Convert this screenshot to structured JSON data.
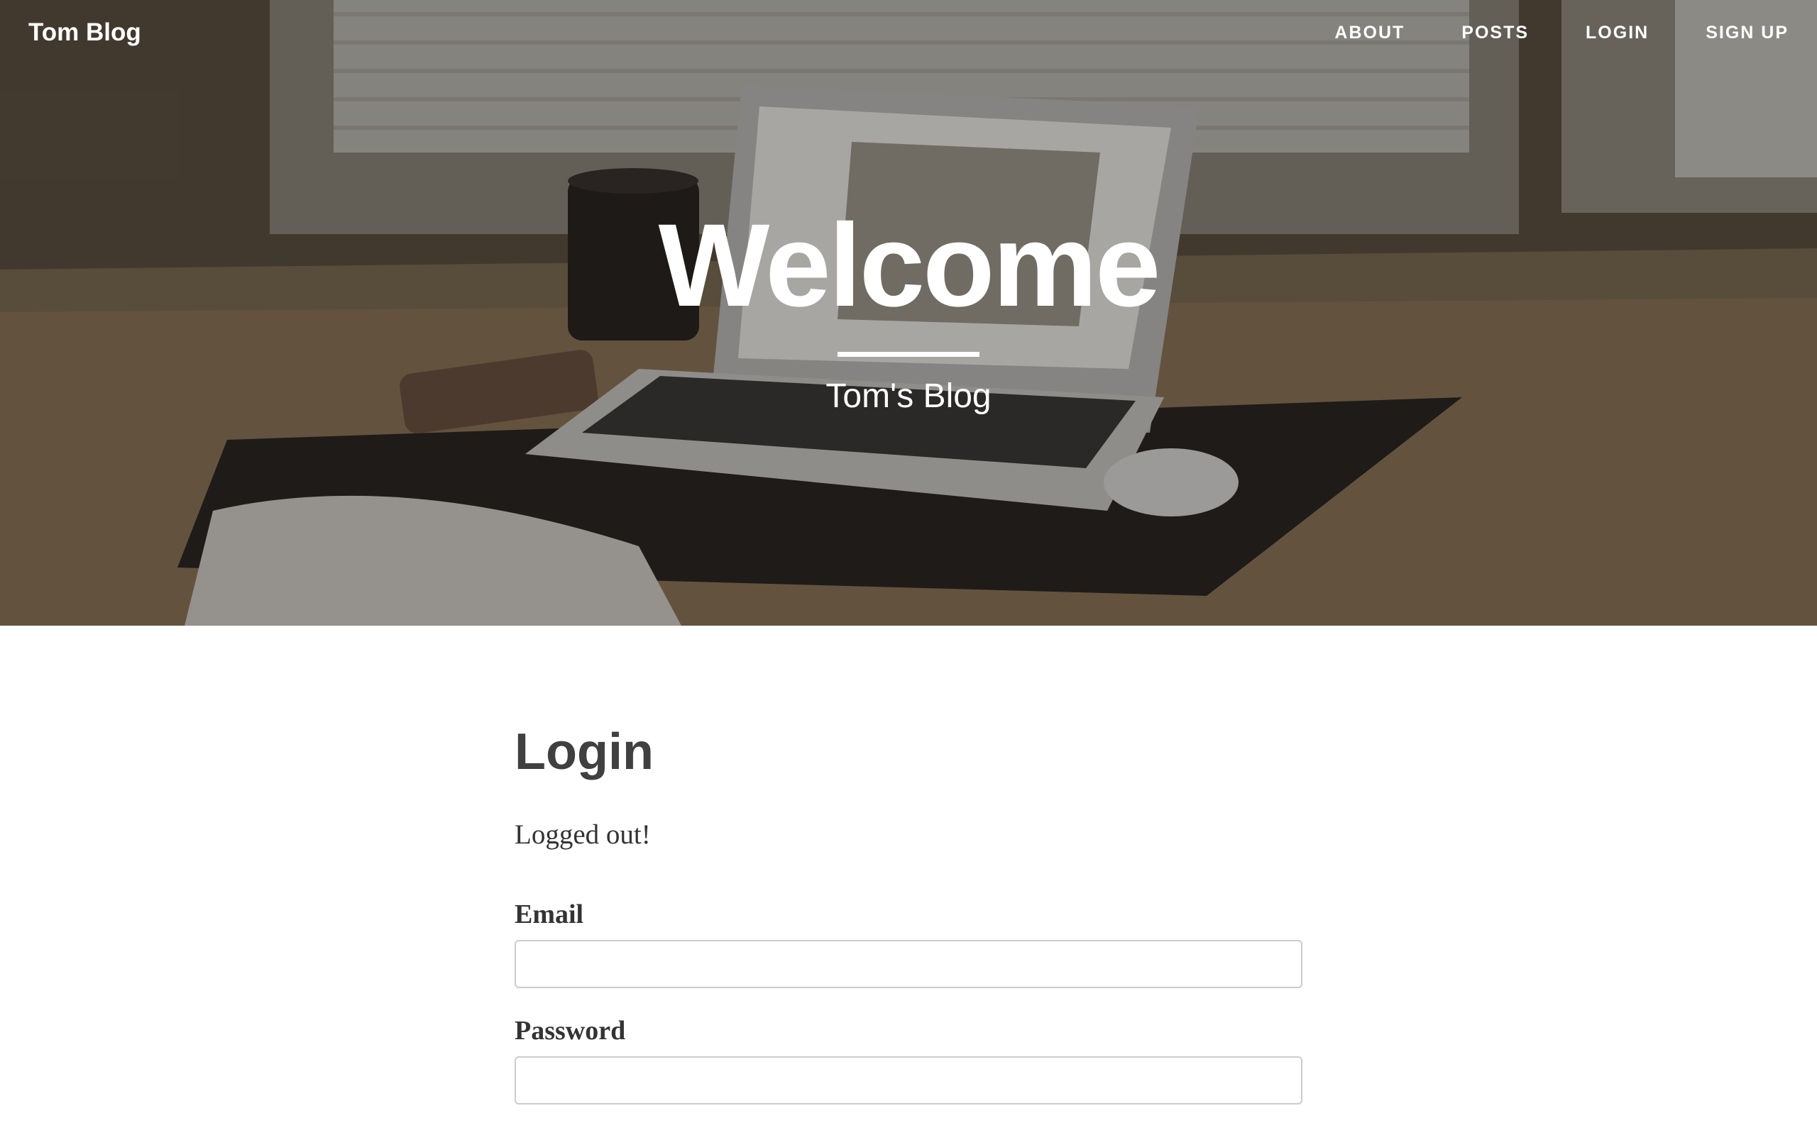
{
  "navbar": {
    "brand": "Tom Blog",
    "links": [
      {
        "label": "ABOUT"
      },
      {
        "label": "POSTS"
      },
      {
        "label": "LOGIN"
      },
      {
        "label": "SIGN UP"
      }
    ]
  },
  "hero": {
    "title": "Welcome",
    "subtitle": "Tom's Blog"
  },
  "main": {
    "title": "Login",
    "flash_message": "Logged out!",
    "form": {
      "email_label": "Email",
      "email_value": "",
      "password_label": "Password",
      "password_value": ""
    }
  },
  "colors": {
    "text": "#404040",
    "hero_text": "#ffffff",
    "input_border": "#cccccc"
  }
}
